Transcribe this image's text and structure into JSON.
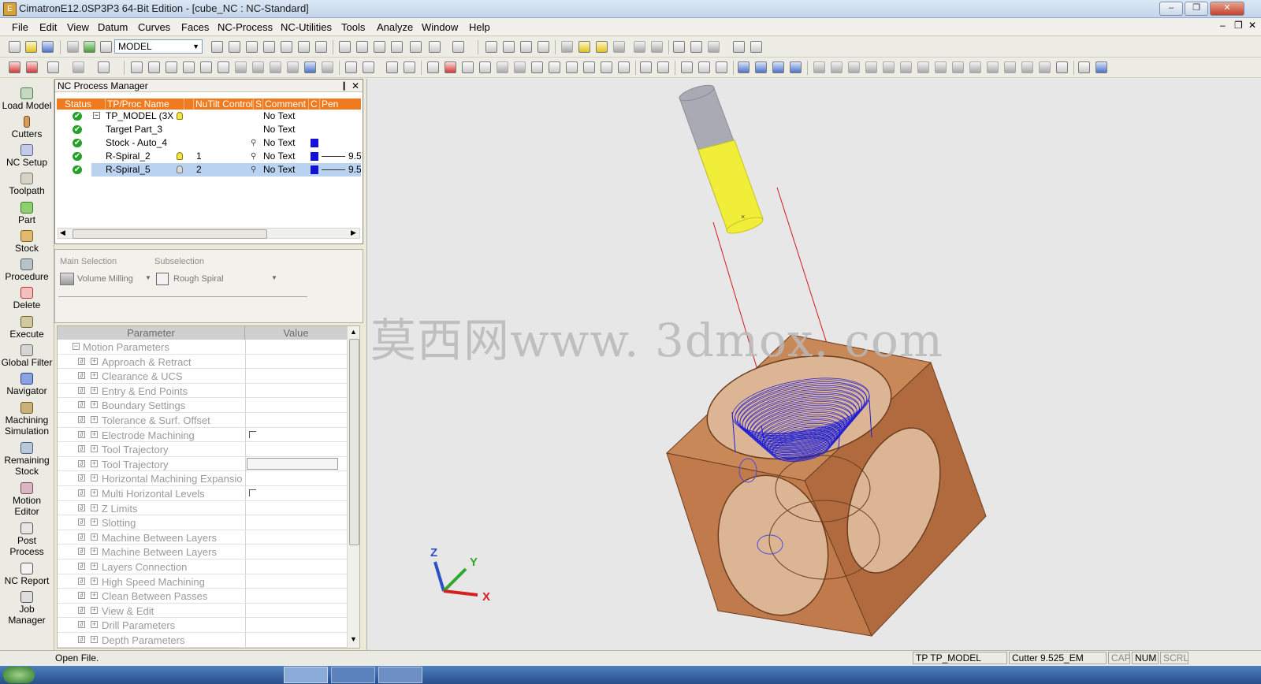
{
  "window": {
    "title": "CimatronE12.0SP3P3  64-Bit Edition - [cube_NC : NC-Standard]",
    "app_icon": "E",
    "controls": [
      "minimize-icon",
      "restore-icon",
      "close-icon"
    ]
  },
  "menu": [
    "File",
    "Edit",
    "View",
    "Datum",
    "Curves",
    "Faces",
    "NC-Process",
    "NC-Utilities",
    "Tools",
    "Analyze",
    "Window",
    "Help"
  ],
  "toolbar": {
    "model_combo": "MODEL"
  },
  "sidebar": [
    {
      "label": "Load Model",
      "icon": "load-model-icon"
    },
    {
      "label": "Cutters",
      "icon": "cutter-icon"
    },
    {
      "label": "NC Setup",
      "icon": "nc-setup-icon"
    },
    {
      "label": "Toolpath",
      "icon": "toolpath-icon"
    },
    {
      "label": "Part",
      "icon": "part-icon"
    },
    {
      "label": "Stock",
      "icon": "stock-icon"
    },
    {
      "label": "Procedure",
      "icon": "procedure-icon"
    },
    {
      "label": "Delete",
      "icon": "delete-icon"
    },
    {
      "label": "Execute",
      "icon": "execute-icon"
    },
    {
      "label": "Global Filter",
      "icon": "filter-icon"
    },
    {
      "label": "Navigator",
      "icon": "navigator-icon"
    },
    {
      "label": "Machining Simulation",
      "icon": "simulation-icon"
    },
    {
      "label": "Remaining Stock",
      "icon": "remaining-stock-icon"
    },
    {
      "label": "Motion Editor",
      "icon": "motion-editor-icon"
    },
    {
      "label": "Post Process",
      "icon": "post-process-icon"
    },
    {
      "label": "NC Report",
      "icon": "report-icon"
    },
    {
      "label": "Job Manager",
      "icon": "job-manager-icon"
    }
  ],
  "nc_process_manager": {
    "title": "NC Process Manager",
    "columns": [
      "Status",
      "TP/Proc Name",
      "",
      "NuTilt Control",
      "S",
      "Comment",
      "C",
      "Pen"
    ],
    "rows": [
      {
        "name": "TP_MODEL (3X",
        "num": "",
        "comment": "No Text",
        "expander": "−",
        "bulb": "yellow"
      },
      {
        "name": "Target Part_3",
        "num": "",
        "comment": "No Text"
      },
      {
        "name": "Stock - Auto_4",
        "num": "",
        "comment": "No Text"
      },
      {
        "name": "R-Spiral_2",
        "num": "1",
        "comment": "No Text",
        "bulb": "yellow",
        "pen": "9.5"
      },
      {
        "name": "R-Spiral_5",
        "num": "2",
        "comment": "No Text",
        "bulb": "gray",
        "pen": "9.5",
        "selected": true
      }
    ],
    "pen_color": "#1410d8",
    "status_color": "#25a028"
  },
  "selection": {
    "main_label": "Main Selection",
    "main_value": "Volume Milling",
    "sub_label": "Subselection",
    "sub_value": "Rough Spiral"
  },
  "parameters": {
    "header_param": "Parameter",
    "header_value": "Value",
    "group": "Motion Parameters",
    "items": [
      {
        "label": "Approach & Retract",
        "value": ""
      },
      {
        "label": "Clearance & UCS",
        "value": ""
      },
      {
        "label": "Entry & End Points",
        "value": ""
      },
      {
        "label": "Boundary Settings",
        "value": ""
      },
      {
        "label": "Tolerance & Surf. Offset",
        "value": ""
      },
      {
        "label": "Electrode Machining",
        "value": "checkbox"
      },
      {
        "label": "Tool Trajectory",
        "value": ""
      },
      {
        "label": "Tool Trajectory",
        "value": "field"
      },
      {
        "label": "Horizontal Machining Expansio",
        "value": ""
      },
      {
        "label": "Multi Horizontal Levels",
        "value": "checkbox"
      },
      {
        "label": "Z Limits",
        "value": ""
      },
      {
        "label": "Slotting",
        "value": ""
      },
      {
        "label": "Machine Between Layers",
        "value": ""
      },
      {
        "label": "Machine Between Layers",
        "value": ""
      },
      {
        "label": "Layers Connection",
        "value": ""
      },
      {
        "label": "High Speed Machining",
        "value": ""
      },
      {
        "label": "Clean Between Passes",
        "value": ""
      },
      {
        "label": "View & Edit",
        "value": ""
      },
      {
        "label": "Drill Parameters",
        "value": ""
      },
      {
        "label": "Depth Parameters",
        "value": ""
      }
    ]
  },
  "viewport": {
    "watermark": "莫西网www. 3dmox. com",
    "axes": {
      "x": "X",
      "y": "Y",
      "z": "Z"
    },
    "colors": {
      "part": "#c98858",
      "toolpath": "#1e1ed6",
      "cutter": "#f1ee3a",
      "holder": "#a9aab4",
      "feed": "#d11a1a"
    }
  },
  "status": {
    "message": "Open File.",
    "tp": "TP  TP_MODEL",
    "cutter": "Cutter  9.525_EM",
    "cap": "CAP",
    "num": "NUM",
    "scrl": "SCRL"
  }
}
